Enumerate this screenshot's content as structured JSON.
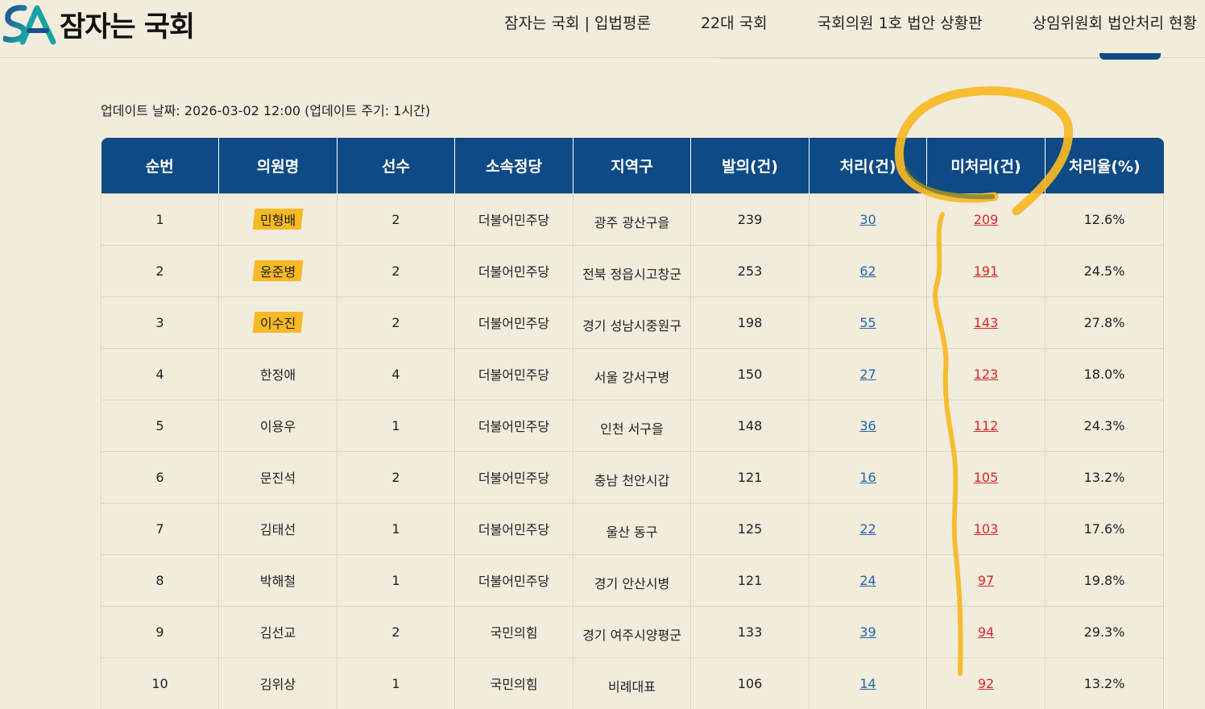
{
  "header": {
    "logo_text": "잠자는 국회",
    "logo_mark": "SA",
    "nav": [
      {
        "label": "잠자는 국회 | 입법평론"
      },
      {
        "label": "22대 국회"
      },
      {
        "label": "국회의원 1호 법안 상황판"
      },
      {
        "label": "상임위원회 법안처리 현황"
      }
    ]
  },
  "update_text": "업데이트 날짜: 2026-03-02 12:00 (업데이트 주기: 1시간)",
  "table": {
    "columns": [
      "순번",
      "의원명",
      "선수",
      "소속정당",
      "지역구",
      "발의(건)",
      "처리(건)",
      "미처리(건)",
      "처리율(%)"
    ],
    "rows": [
      {
        "no": "1",
        "name": "민형배",
        "terms": "2",
        "party": "더불어민주당",
        "region": "광주 광산구을",
        "proposed": "239",
        "processed": "30",
        "pending": "209",
        "rate": "12.6%",
        "highlight": true
      },
      {
        "no": "2",
        "name": "윤준병",
        "terms": "2",
        "party": "더불어민주당",
        "region": "전북 정읍시고창군",
        "proposed": "253",
        "processed": "62",
        "pending": "191",
        "rate": "24.5%",
        "highlight": true
      },
      {
        "no": "3",
        "name": "이수진",
        "terms": "2",
        "party": "더불어민주당",
        "region": "경기 성남시중원구",
        "proposed": "198",
        "processed": "55",
        "pending": "143",
        "rate": "27.8%",
        "highlight": true
      },
      {
        "no": "4",
        "name": "한정애",
        "terms": "4",
        "party": "더불어민주당",
        "region": "서울 강서구병",
        "proposed": "150",
        "processed": "27",
        "pending": "123",
        "rate": "18.0%",
        "highlight": false
      },
      {
        "no": "5",
        "name": "이용우",
        "terms": "1",
        "party": "더불어민주당",
        "region": "인천 서구을",
        "proposed": "148",
        "processed": "36",
        "pending": "112",
        "rate": "24.3%",
        "highlight": false
      },
      {
        "no": "6",
        "name": "문진석",
        "terms": "2",
        "party": "더불어민주당",
        "region": "충남 천안시갑",
        "proposed": "121",
        "processed": "16",
        "pending": "105",
        "rate": "13.2%",
        "highlight": false
      },
      {
        "no": "7",
        "name": "김태선",
        "terms": "1",
        "party": "더불어민주당",
        "region": "울산 동구",
        "proposed": "125",
        "processed": "22",
        "pending": "103",
        "rate": "17.6%",
        "highlight": false
      },
      {
        "no": "8",
        "name": "박해철",
        "terms": "1",
        "party": "더불어민주당",
        "region": "경기 안산시병",
        "proposed": "121",
        "processed": "24",
        "pending": "97",
        "rate": "19.8%",
        "highlight": false
      },
      {
        "no": "9",
        "name": "김선교",
        "terms": "2",
        "party": "국민의힘",
        "region": "경기 여주시양평군",
        "proposed": "133",
        "processed": "39",
        "pending": "94",
        "rate": "29.3%",
        "highlight": false
      },
      {
        "no": "10",
        "name": "김위상",
        "terms": "1",
        "party": "국민의힘",
        "region": "비례대표",
        "proposed": "106",
        "processed": "14",
        "pending": "92",
        "rate": "13.2%",
        "highlight": false
      }
    ]
  },
  "colors": {
    "header_bg": "#0e4a85",
    "page_bg": "#f1ecdc",
    "link_blue": "#2467a8",
    "link_red": "#d9262b",
    "highlight": "#f7b924"
  }
}
